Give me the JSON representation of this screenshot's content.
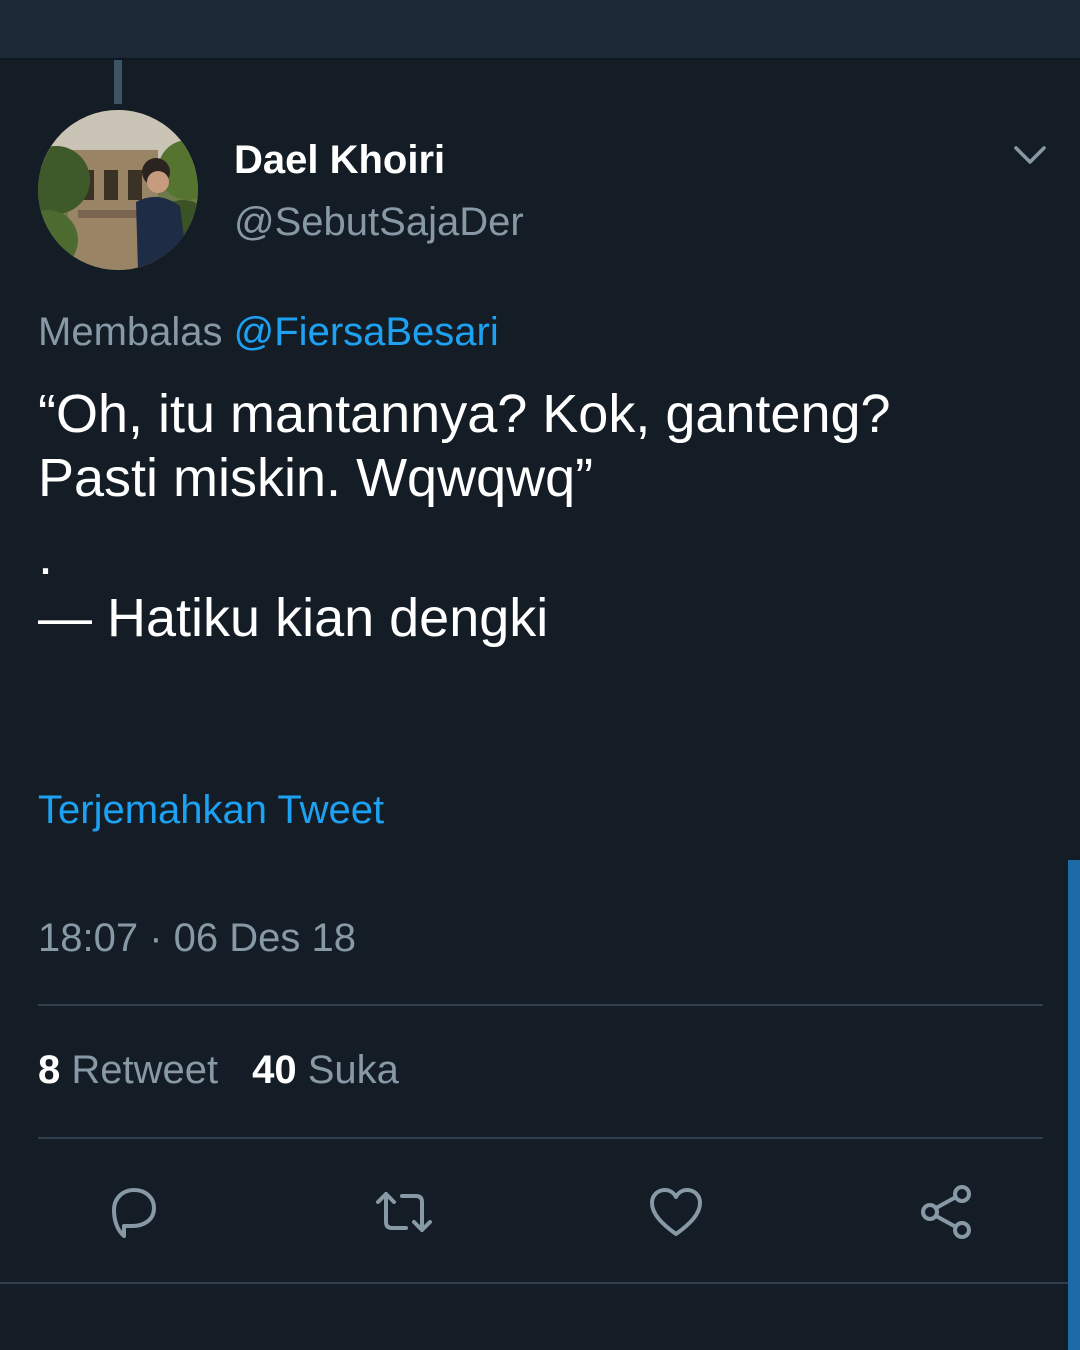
{
  "colors": {
    "background": "#141d26",
    "topbar": "#1b2836",
    "text_primary": "#ffffff",
    "text_secondary": "#8899a6",
    "accent": "#1da1f2",
    "divider": "#2f3f4e"
  },
  "tweet": {
    "display_name": "Dael Khoiri",
    "handle": "@SebutSajaDer",
    "reply_prefix": "Membalas",
    "reply_mention": "@FiersaBesari",
    "text_lines": [
      "“Oh, itu mantannya? Kok, ganteng?",
      "Pasti miskin. Wqwqwq”",
      ".",
      "— Hatiku kian dengki"
    ],
    "translate_link": "Terjemahkan Tweet",
    "timestamp": "18:07 · 06 Des 18",
    "retweet_count": "8",
    "retweet_label": "Retweet",
    "like_count": "40",
    "like_label": "Suka"
  },
  "icons": {
    "back": "chevron-left-icon",
    "menu": "chevron-down-icon",
    "reply": "reply-bubble-icon",
    "retweet": "retweet-icon",
    "like": "heart-icon",
    "share": "share-icon"
  }
}
